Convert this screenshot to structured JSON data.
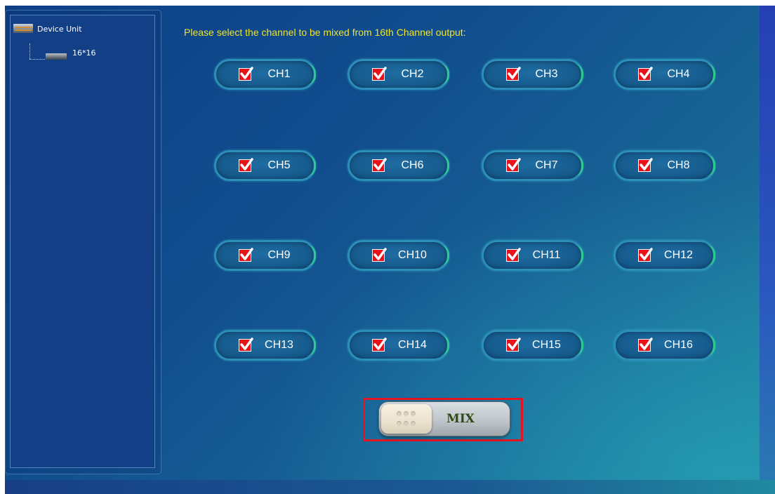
{
  "tree": {
    "root_label": "Device Unit",
    "child_label": "16*16"
  },
  "prompt": "Please select the channel to be mixed from 16th Channel output:",
  "channels": [
    {
      "label": "CH1",
      "checked": true
    },
    {
      "label": "CH2",
      "checked": true
    },
    {
      "label": "CH3",
      "checked": true
    },
    {
      "label": "CH4",
      "checked": true
    },
    {
      "label": "CH5",
      "checked": true
    },
    {
      "label": "CH6",
      "checked": true
    },
    {
      "label": "CH7",
      "checked": true
    },
    {
      "label": "CH8",
      "checked": true
    },
    {
      "label": "CH9",
      "checked": true
    },
    {
      "label": "CH10",
      "checked": true
    },
    {
      "label": "CH11",
      "checked": true
    },
    {
      "label": "CH12",
      "checked": true
    },
    {
      "label": "CH13",
      "checked": true
    },
    {
      "label": "CH14",
      "checked": true
    },
    {
      "label": "CH15",
      "checked": true
    },
    {
      "label": "CH16",
      "checked": true
    }
  ],
  "mix": {
    "label": "MIX",
    "state": "off"
  },
  "colors": {
    "prompt_text": "#f0e42a",
    "checkbox_red": "#e8121b",
    "highlight_outline": "#e21622"
  }
}
